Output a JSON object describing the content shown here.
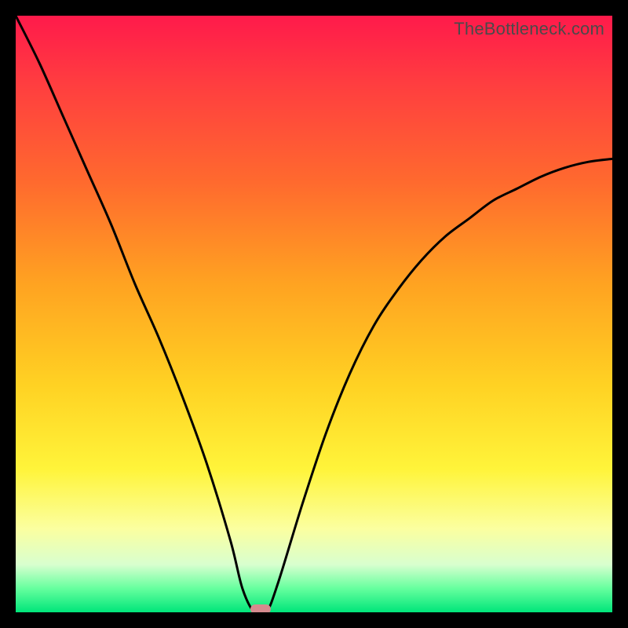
{
  "watermark": "TheBottleneck.com",
  "colors": {
    "page_bg": "#000000",
    "gradient_top": "#ff1a4b",
    "gradient_bottom": "#00e57a",
    "curve": "#000000",
    "marker": "#d58a8e"
  },
  "chart_data": {
    "type": "line",
    "title": "",
    "xlabel": "",
    "ylabel": "",
    "xlim": [
      0,
      100
    ],
    "ylim": [
      0,
      100
    ],
    "grid": false,
    "legend": false,
    "series": [
      {
        "name": "bottleneck-curve",
        "x": [
          0,
          4,
          8,
          12,
          16,
          20,
          24,
          28,
          32,
          36,
          38,
          40,
          42,
          44,
          48,
          52,
          56,
          60,
          64,
          68,
          72,
          76,
          80,
          84,
          88,
          92,
          96,
          100
        ],
        "y": [
          100,
          92,
          83,
          74,
          65,
          55,
          46,
          36,
          25,
          12,
          4,
          0,
          0,
          5,
          18,
          30,
          40,
          48,
          54,
          59,
          63,
          66,
          69,
          71,
          73,
          74.5,
          75.5,
          76
        ]
      }
    ],
    "marker": {
      "x": 41,
      "y": 0
    },
    "background_gradient": {
      "stops": [
        {
          "pos": 0.0,
          "color": "#ff1a4b"
        },
        {
          "pos": 0.12,
          "color": "#ff3f3f"
        },
        {
          "pos": 0.28,
          "color": "#ff6a2e"
        },
        {
          "pos": 0.45,
          "color": "#ffa321"
        },
        {
          "pos": 0.62,
          "color": "#ffd223"
        },
        {
          "pos": 0.76,
          "color": "#fff43a"
        },
        {
          "pos": 0.86,
          "color": "#fbffa0"
        },
        {
          "pos": 0.92,
          "color": "#d8ffcf"
        },
        {
          "pos": 0.96,
          "color": "#66ff9e"
        },
        {
          "pos": 1.0,
          "color": "#00e57a"
        }
      ]
    }
  }
}
